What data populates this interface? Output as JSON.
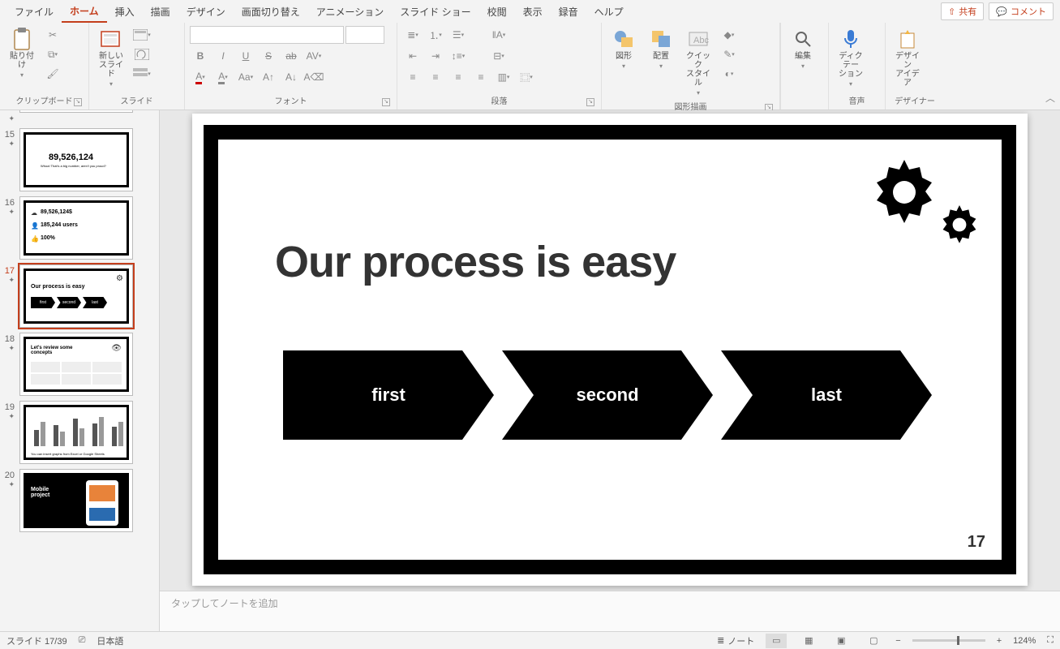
{
  "menu": {
    "tabs": [
      "ファイル",
      "ホーム",
      "挿入",
      "描画",
      "デザイン",
      "画面切り替え",
      "アニメーション",
      "スライド ショー",
      "校閲",
      "表示",
      "録音",
      "ヘルプ"
    ],
    "active_index": 1,
    "share": "共有",
    "comment": "コメント"
  },
  "ribbon": {
    "clipboard": {
      "paste": "貼り付け",
      "label": "クリップボード"
    },
    "slides": {
      "newslide": "新しい\nスライド",
      "label": "スライド"
    },
    "font": {
      "label": "フォント"
    },
    "paragraph": {
      "label": "段落"
    },
    "drawing": {
      "shapes": "図形",
      "arrange": "配置",
      "quick": "クイック\nスタイル",
      "label": "図形描画"
    },
    "editing": {
      "edit": "編集"
    },
    "voice": {
      "dictate": "ディクテー\nション",
      "label": "音声"
    },
    "designer": {
      "ideas": "デザイン\nアイデア",
      "label": "デザイナー"
    }
  },
  "thumbs": {
    "items": [
      {
        "num": "",
        "kind": "map"
      },
      {
        "num": "15",
        "kind": "bignum",
        "big": "89,526,124",
        "sub": "Whoa! That's a big number, aren't you proud?"
      },
      {
        "num": "16",
        "kind": "stats",
        "l1": "89,526,124$",
        "l2": "185,244 users",
        "l3": "100%"
      },
      {
        "num": "17",
        "kind": "process",
        "title": "Our process is easy",
        "a": "first",
        "b": "second",
        "c": "last",
        "selected": true
      },
      {
        "num": "18",
        "kind": "concepts",
        "title": "Let's review some\nconcepts"
      },
      {
        "num": "19",
        "kind": "chart",
        "caption": "You can insert graphs from Excel or Google Sheets"
      },
      {
        "num": "20",
        "kind": "mobile",
        "title": "Mobile\nproject"
      }
    ]
  },
  "slide": {
    "title": "Our process is easy",
    "steps": [
      "first",
      "second",
      "last"
    ],
    "page": "17"
  },
  "notes_placeholder": "タップしてノートを追加",
  "status": {
    "slide": "スライド 17/39",
    "lang": "日本語",
    "notes": "ノート",
    "zoom": "124%"
  }
}
